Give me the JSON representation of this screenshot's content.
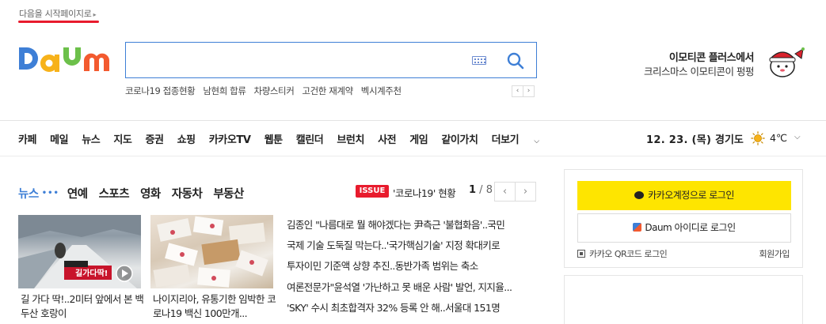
{
  "top": {
    "start_page_link": "다음을 시작페이지로",
    "start_arrow": "▸"
  },
  "logo": {
    "text": "Daum"
  },
  "search": {
    "value": "",
    "placeholder": "",
    "keywords": [
      "코로나19 접종현황",
      "남현희 합류",
      "차량스티커",
      "고건한 재계약",
      "벡시계주천"
    ],
    "prev": "‹",
    "next": "›"
  },
  "promo": {
    "title": "이모티콘 플러스에서",
    "subtitle": "크리스마스 이모티콘이 펑펑"
  },
  "gnb": {
    "items": [
      "카페",
      "메일",
      "뉴스",
      "지도",
      "증권",
      "쇼핑",
      "카카오TV",
      "웹툰",
      "캘린더",
      "브런치",
      "사전",
      "게임",
      "같이가치",
      "더보기"
    ],
    "more_chevron": "⌵"
  },
  "weather": {
    "date": "12. 23. (목)",
    "region": "경기도",
    "temp": "4℃",
    "chevron": "⌵"
  },
  "news": {
    "tabs": [
      "뉴스",
      "연예",
      "스포츠",
      "영화",
      "자동차",
      "부동산"
    ],
    "dots": "•••",
    "issue_badge": "ISSUE",
    "issue_text": "'코로나19' 현황",
    "page_current": "1",
    "page_total": " / 8",
    "prev": "‹",
    "next": "›",
    "thumbs": [
      {
        "caption": "길 가다 딱!..2미터 앞에서 본 백두산 호랑이",
        "overlay": "길가다딱!"
      },
      {
        "caption": "나이지리아, 유통기한 임박한 코로나19 백신 100만개..."
      }
    ],
    "headlines": [
      "김종인 \"나름대로 뭘 해야겠다는 尹측근 '불협화음'..국민",
      "국제 기술 도둑질 막는다..'국가핵심기술' 지정 확대키로",
      "투자이민 기준액 상향 추진..동반가족 범위는 축소",
      "여론전문가\"윤석열 '가난하고 못 배운 사람' 발언, 지지율...",
      "'SKY' 수시 최초합격자 32% 등록 안 해..서울대 151명"
    ]
  },
  "login": {
    "kakao_label": "카카오계정으로 로그인",
    "daum_label": "Daum 아이디로 로그인",
    "qr_label": "카카오 QR코드 로그인",
    "signup_label": "회원가입"
  },
  "colors": {
    "accent": "#3e7fd6",
    "brand_red": "#e81b2d",
    "kakao_yellow": "#fee500"
  }
}
